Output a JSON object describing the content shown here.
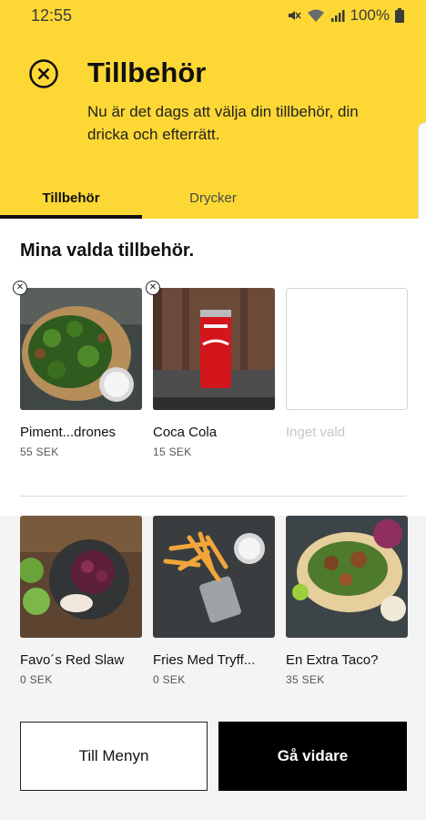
{
  "status_bar": {
    "time": "12:55",
    "battery_text": "100%",
    "icons": [
      "mute-icon",
      "wifi-icon",
      "signal-icon",
      "battery-icon"
    ]
  },
  "header": {
    "title": "Tillbehör",
    "subtitle": "Nu är det dags att välja din tillbehör, din dricka och efterrätt.",
    "close_icon": "close-circle-icon",
    "background_color": "#fdd835"
  },
  "tabs": [
    {
      "label": "Tillbehör",
      "active": true
    },
    {
      "label": "Drycker",
      "active": false
    }
  ],
  "selected": {
    "title": "Mina valda tillbehör.",
    "items": [
      {
        "name": "Piment...drones",
        "price": "55 SEK"
      },
      {
        "name": "Coca Cola",
        "price": "15 SEK"
      }
    ],
    "empty_label": "Inget vald"
  },
  "options": [
    {
      "name": "Favo´s Red Slaw",
      "price": "0 SEK"
    },
    {
      "name": "Fries Med Tryff...",
      "price": "0 SEK"
    },
    {
      "name": "En Extra Taco?",
      "price": "35 SEK"
    }
  ],
  "buttons": {
    "menu_label": "Till Menyn",
    "next_label": "Gå vidare"
  }
}
